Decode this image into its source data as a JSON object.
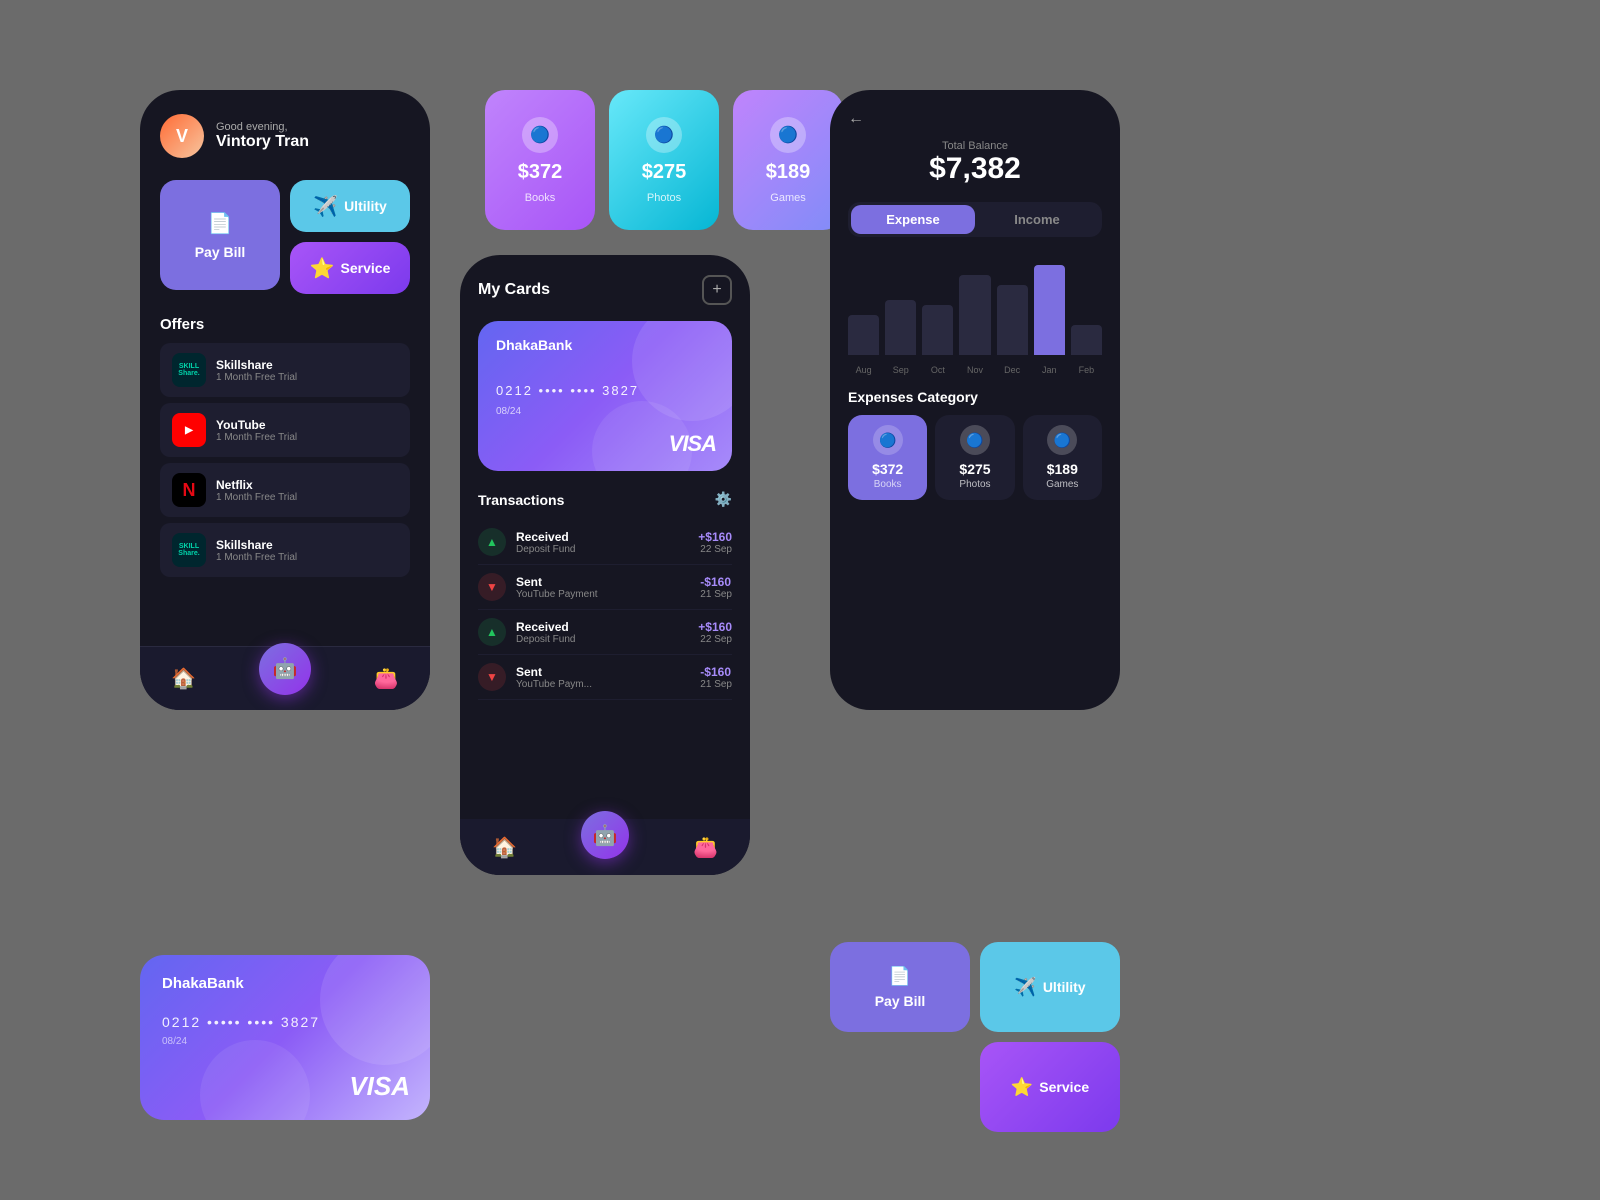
{
  "app": {
    "background": "#6b6b6b"
  },
  "left_phone": {
    "greeting": "Good evening,",
    "user_name": "Vintory Tran",
    "avatar_letter": "V",
    "actions": {
      "pay_bill": "Pay Bill",
      "utility": "Ultility",
      "service": "Service"
    },
    "offers_title": "Offers",
    "offers": [
      {
        "name": "Skillshare",
        "sub": "1 Month Free Trial",
        "type": "skillshare"
      },
      {
        "name": "YouTube",
        "sub": "1 Month Free Trial",
        "type": "youtube"
      },
      {
        "name": "Netflix",
        "sub": "1 Month Free Trial",
        "type": "netflix"
      },
      {
        "name": "Skillshare",
        "sub": "1 Month Free Trial",
        "type": "skillshare"
      }
    ]
  },
  "top_mini_cards": [
    {
      "amount": "$372",
      "label": "Books",
      "color": "purple"
    },
    {
      "amount": "$275",
      "label": "Photos",
      "color": "cyan"
    },
    {
      "amount": "$189",
      "label": "Games",
      "color": "violet"
    }
  ],
  "center_phone": {
    "title": "My Cards",
    "card": {
      "bank": "DhakaBank",
      "number": "0212  ••••  ••••  3827",
      "expiry": "08/24",
      "network": "VISA"
    },
    "transactions_title": "Transactions",
    "transactions": [
      {
        "type": "received",
        "name": "Received",
        "sub": "Deposit Fund",
        "amount": "+$160",
        "date": "22 Sep"
      },
      {
        "type": "sent",
        "name": "Sent",
        "sub": "YouTube Payment",
        "amount": "-$160",
        "date": "21 Sep"
      },
      {
        "type": "received",
        "name": "Received",
        "sub": "Deposit Fund",
        "amount": "+$160",
        "date": "22 Sep"
      },
      {
        "type": "sent",
        "name": "Sent",
        "sub": "YouTube Paym...",
        "amount": "-$160",
        "date": "21 Sep"
      }
    ]
  },
  "right_phone": {
    "balance_label": "Total Balance",
    "balance_amount": "$7,382",
    "toggle": {
      "expense": "Expense",
      "income": "Income",
      "active": "expense"
    },
    "chart": {
      "labels": [
        "Aug",
        "Sep",
        "Oct",
        "Nov",
        "Dec",
        "Jan",
        "Feb"
      ],
      "heights": [
        40,
        55,
        50,
        80,
        70,
        90,
        30
      ],
      "active_index": 5
    },
    "category_title": "Expenses Category",
    "categories": [
      {
        "amount": "$372",
        "label": "Books",
        "highlighted": true
      },
      {
        "amount": "$275",
        "label": "Photos",
        "highlighted": false
      },
      {
        "amount": "$189",
        "label": "Games",
        "highlighted": false
      }
    ]
  },
  "bottom_card": {
    "bank": "DhakaBank",
    "number": "0212  •••••  ••••  3827",
    "expiry": "08/24",
    "network": "VISA"
  },
  "bottom_right": {
    "pay_bill": "Pay Bill",
    "utility": "Ultility",
    "service": "Service"
  }
}
